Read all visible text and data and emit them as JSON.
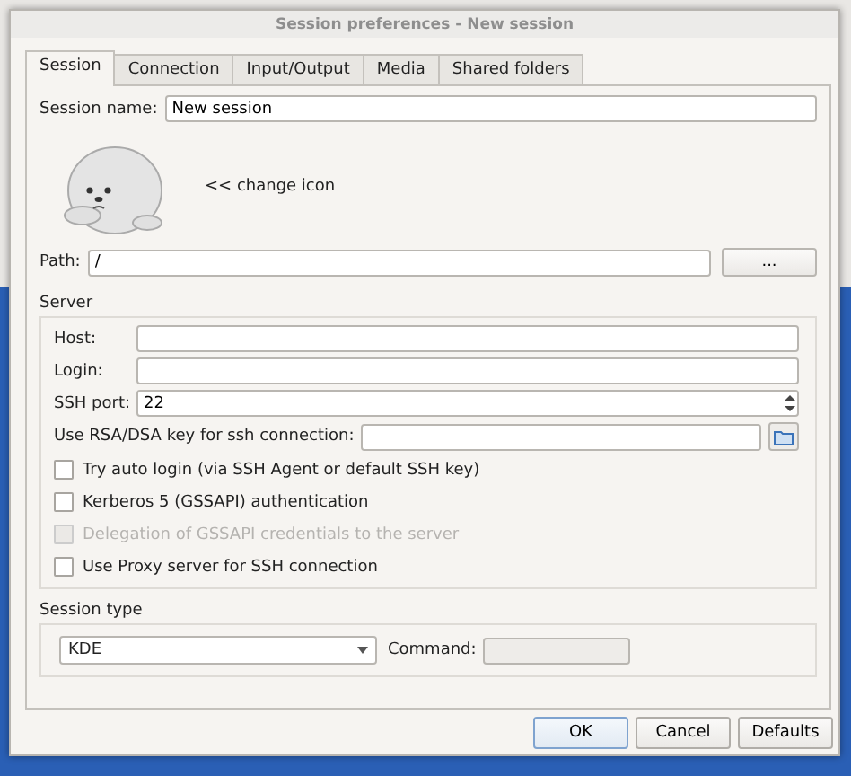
{
  "window": {
    "title": "Session preferences - New session"
  },
  "tabs": [
    {
      "label": "Session",
      "selected": true
    },
    {
      "label": "Connection",
      "selected": false
    },
    {
      "label": "Input/Output",
      "selected": false
    },
    {
      "label": "Media",
      "selected": false
    },
    {
      "label": "Shared folders",
      "selected": false
    }
  ],
  "session_name": {
    "label": "Session name:",
    "value": "New session"
  },
  "icon": {
    "label": "<< change icon"
  },
  "path": {
    "label": "Path:",
    "value": "/",
    "button": "..."
  },
  "server": {
    "title": "Server",
    "fields": [
      {
        "kind": "text",
        "label": "Host:"
      },
      {
        "kind": "text",
        "label": "Login:"
      },
      {
        "kind": "spin",
        "label": "SSH port:",
        "value": "22"
      }
    ],
    "key": {
      "label": "Use RSA/DSA key for ssh connection:"
    },
    "options": [
      {
        "label": "Try auto login (via SSH Agent or default SSH key)",
        "checked": false,
        "disabled": false
      },
      {
        "label": "Kerberos 5 (GSSAPI) authentication",
        "checked": false,
        "disabled": false
      },
      {
        "label": "Delegation of GSSAPI credentials to the server",
        "checked": false,
        "disabled": true
      },
      {
        "label": "Use Proxy server for SSH connection",
        "checked": false,
        "disabled": false
      }
    ]
  },
  "session_type": {
    "title": "Session type",
    "value": "KDE",
    "command_label": "Command:",
    "command_disabled": true
  },
  "buttons": [
    {
      "label": "OK",
      "default": true
    },
    {
      "label": "Cancel",
      "default": false
    },
    {
      "label": "Defaults",
      "default": false
    }
  ]
}
